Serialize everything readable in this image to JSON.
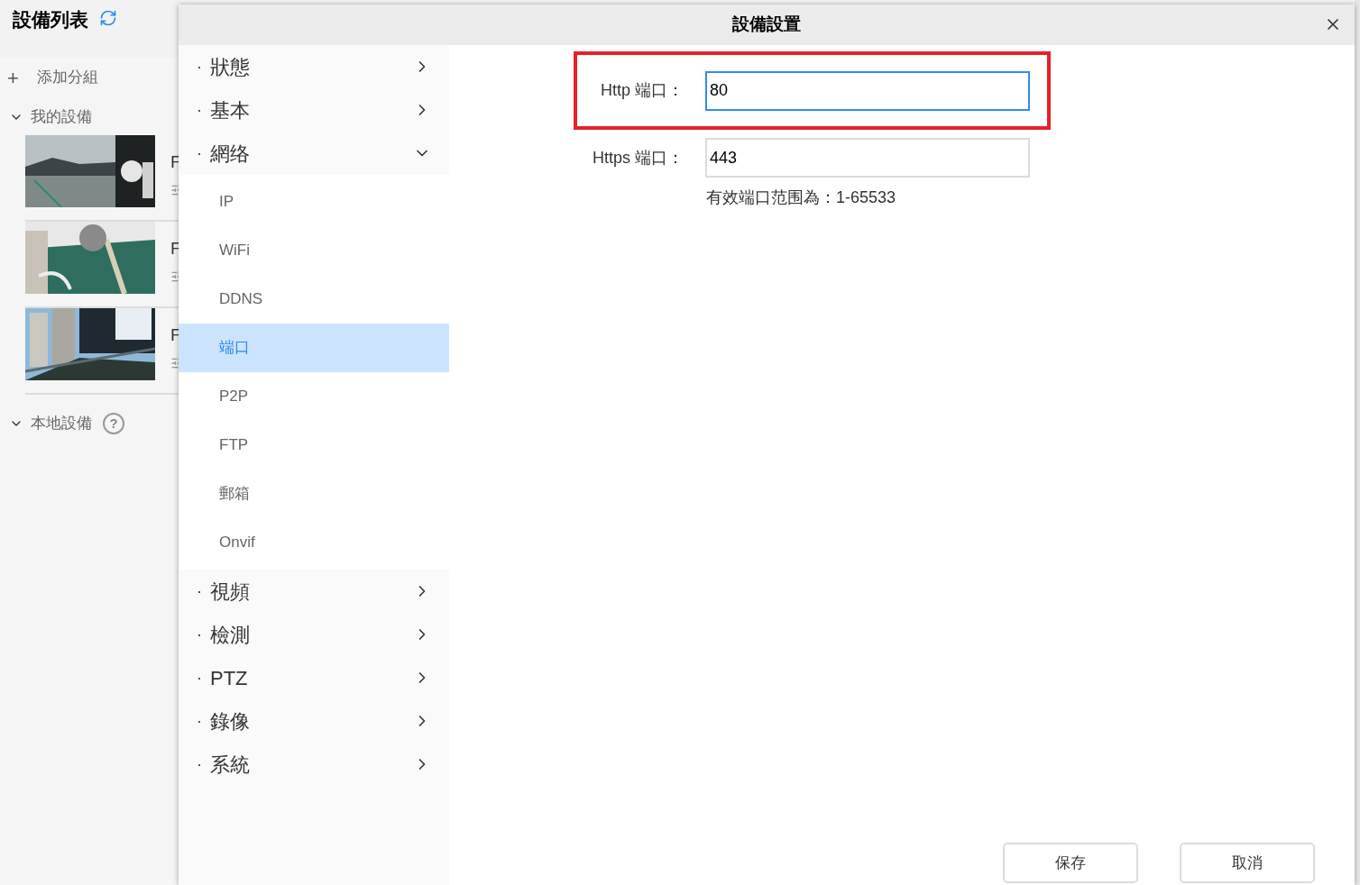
{
  "sidebar": {
    "title": "設備列表",
    "add_group": {
      "icon": "+",
      "label": "添加分組"
    },
    "groups": [
      {
        "label": "我的設備",
        "expanded": true,
        "devices": [
          {
            "kind": "picture",
            "name": "F"
          },
          {
            "kind": "picture",
            "name": "F"
          },
          {
            "kind": "picture",
            "name": "F"
          }
        ]
      },
      {
        "label": "本地設備",
        "expanded": true,
        "help": "?"
      }
    ]
  },
  "dialog": {
    "title": "設備設置",
    "nav": [
      {
        "bullet": "·",
        "label": "狀態",
        "expanded": false
      },
      {
        "bullet": "·",
        "label": "基本",
        "expanded": false
      },
      {
        "bullet": "·",
        "label": "網络",
        "expanded": true,
        "children": [
          {
            "label": "IP",
            "selected": false
          },
          {
            "label": "WiFi",
            "selected": false
          },
          {
            "label": "DDNS",
            "selected": false
          },
          {
            "label": "端口",
            "selected": true
          },
          {
            "label": "P2P",
            "selected": false
          },
          {
            "label": "FTP",
            "selected": false
          },
          {
            "label": "郵箱",
            "selected": false
          },
          {
            "label": "Onvif",
            "selected": false
          }
        ]
      },
      {
        "bullet": "·",
        "label": "視頻",
        "expanded": false
      },
      {
        "bullet": "·",
        "label": "檢測",
        "expanded": false
      },
      {
        "bullet": "·",
        "label": "PTZ",
        "expanded": false
      },
      {
        "bullet": "·",
        "label": "錄像",
        "expanded": false
      },
      {
        "bullet": "·",
        "label": "系統",
        "expanded": false
      }
    ],
    "fields": [
      {
        "label": "Http 端口：",
        "value": "80",
        "focused": true,
        "highlighted": true
      },
      {
        "label": "Https 端口：",
        "value": "443",
        "focused": false,
        "highlighted": false
      }
    ],
    "hint": "有效端口范围為：1-65533",
    "buttons": [
      "保存",
      "取消"
    ]
  }
}
